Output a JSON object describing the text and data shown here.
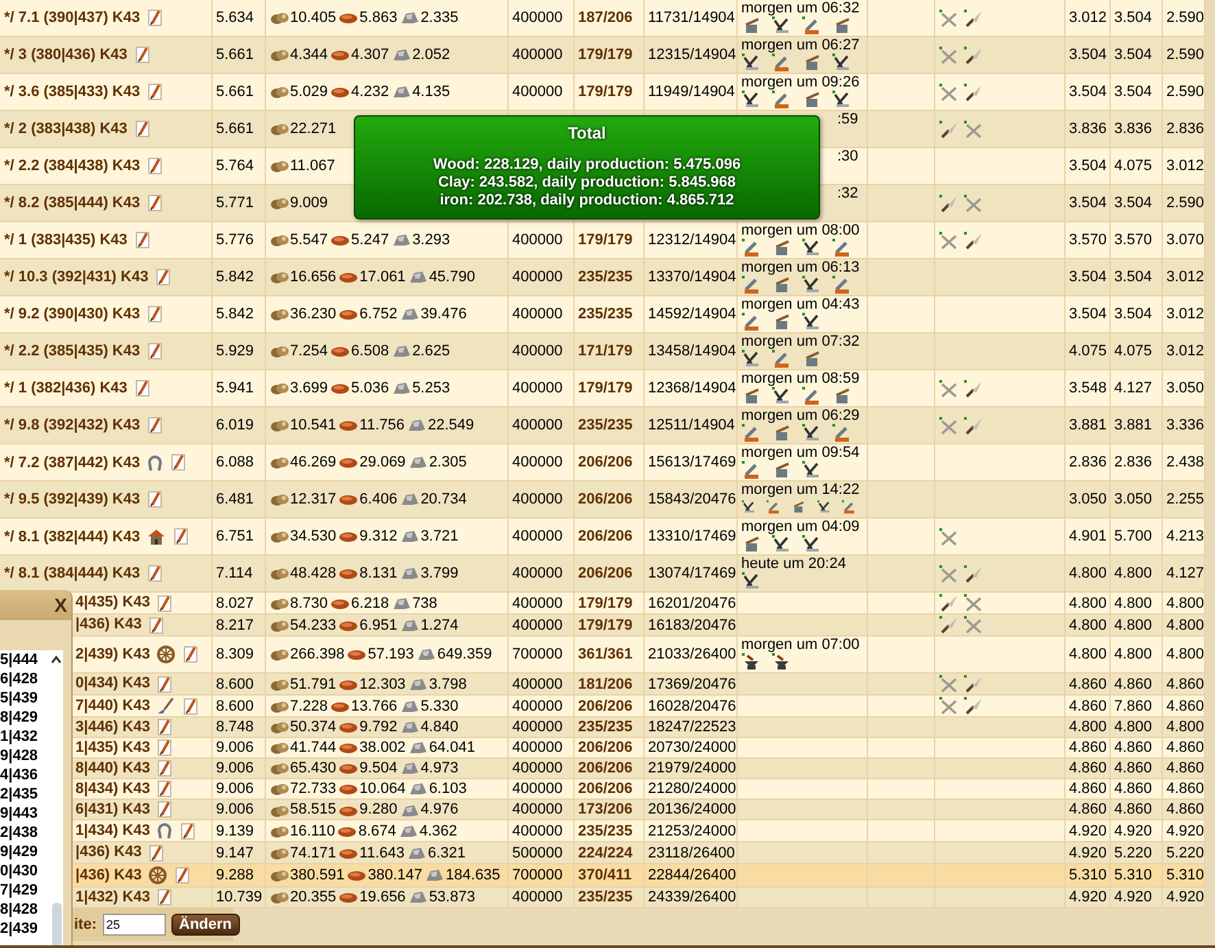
{
  "rows": [
    {
      "name": "*/ 7.1 (390|437) K43",
      "column_2": "5.634",
      "wood": "10.405",
      "clay": "5.863",
      "iron": "2.335",
      "column_4": "400000",
      "column_5": "187/206",
      "column_6": "11731/14904",
      "build": {
        "time": "morgen um 06:32",
        "queue": [
          {
            "kind": "quarry"
          },
          {
            "kind": "axe"
          },
          {
            "kind": "lumber"
          },
          {
            "kind": "quarry"
          }
        ]
      },
      "units": [
        {
          "kind": "crossed"
        },
        {
          "kind": "spear"
        }
      ],
      "column_10": "3.012",
      "column_11": "3.504",
      "column_12": "2.590",
      "selected": false
    },
    {
      "name": "*/ 3 (380|436) K43",
      "column_2": "5.661",
      "wood": "4.344",
      "clay": "4.307",
      "iron": "2.052",
      "column_4": "400000",
      "column_5": "179/179",
      "column_6": "12315/14904",
      "build": {
        "time": "morgen um 06:27",
        "queue": [
          {
            "kind": "axe"
          },
          {
            "kind": "lumber"
          },
          {
            "kind": "quarry"
          },
          {
            "kind": "axe"
          }
        ]
      },
      "units": [
        {
          "kind": "crossed"
        },
        {
          "kind": "spear"
        }
      ],
      "column_10": "3.504",
      "column_11": "3.504",
      "column_12": "2.590",
      "selected": false
    },
    {
      "name": "*/ 3.6 (385|433) K43",
      "column_2": "5.661",
      "wood": "5.029",
      "clay": "4.232",
      "iron": "4.135",
      "column_4": "400000",
      "column_5": "179/179",
      "column_6": "11949/14904",
      "build": {
        "time": "morgen um 09:26",
        "queue": [
          {
            "kind": "axe"
          },
          {
            "kind": "lumber"
          },
          {
            "kind": "quarry"
          },
          {
            "kind": "axe"
          }
        ]
      },
      "units": [
        {
          "kind": "crossed"
        },
        {
          "kind": "spear"
        }
      ],
      "column_10": "3.504",
      "column_11": "3.504",
      "column_12": "2.590",
      "selected": false
    },
    {
      "name": "*/ 2 (383|438) K43",
      "column_2": "5.661",
      "wood": "22.271",
      "build": {
        "time": ":59"
      },
      "units": [
        {
          "kind": "spear"
        },
        {
          "kind": "crossed"
        }
      ],
      "column_10": "3.836",
      "column_11": "3.836",
      "column_12": "2.836",
      "selected": false
    },
    {
      "name": "*/ 2.2 (384|438) K43",
      "column_2": "5.764",
      "wood": "11.067",
      "build": {
        "time": ":30"
      },
      "column_10": "3.504",
      "column_11": "4.075",
      "column_12": "3.012",
      "selected": false
    },
    {
      "name": "*/ 8.2 (385|444) K43",
      "column_2": "5.771",
      "wood": "9.009",
      "build": {
        "time": ":32"
      },
      "units": [
        {
          "kind": "spear"
        },
        {
          "kind": "crossed"
        }
      ],
      "column_10": "3.504",
      "column_11": "3.504",
      "column_12": "2.590",
      "selected": false
    },
    {
      "name": "*/ 1 (383|435) K43",
      "column_2": "5.776",
      "wood": "5.547",
      "clay": "5.247",
      "iron": "3.293",
      "column_4": "400000",
      "column_5": "179/179",
      "column_6": "12312/14904",
      "build": {
        "time": "morgen um 08:00",
        "queue": [
          {
            "kind": "lumber"
          },
          {
            "kind": "quarry"
          },
          {
            "kind": "axe"
          },
          {
            "kind": "lumber"
          }
        ]
      },
      "units": [
        {
          "kind": "crossed"
        },
        {
          "kind": "spear"
        }
      ],
      "column_10": "3.570",
      "column_11": "3.570",
      "column_12": "3.070",
      "selected": false
    },
    {
      "name": "*/ 10.3 (392|431) K43",
      "column_2": "5.842",
      "wood": "16.656",
      "clay": "17.061",
      "iron": "45.790",
      "column_4": "400000",
      "column_5": "235/235",
      "column_6": "13370/14904",
      "build": {
        "time": "morgen um 06:13",
        "queue": [
          {
            "kind": "lumber"
          },
          {
            "kind": "quarry"
          },
          {
            "kind": "axe"
          },
          {
            "kind": "lumber"
          }
        ]
      },
      "column_10": "3.504",
      "column_11": "3.504",
      "column_12": "3.012",
      "selected": false
    },
    {
      "name": "*/ 9.2 (390|430) K43",
      "column_2": "5.842",
      "wood": "36.230",
      "clay": "6.752",
      "iron": "39.476",
      "column_4": "400000",
      "column_5": "235/235",
      "column_6": "14592/14904",
      "build": {
        "time": "morgen um 04:43",
        "queue": [
          {
            "kind": "lumber"
          },
          {
            "kind": "quarry"
          },
          {
            "kind": "axe"
          }
        ]
      },
      "column_10": "3.504",
      "column_11": "3.504",
      "column_12": "3.012",
      "selected": false
    },
    {
      "name": "*/ 2.2 (385|435) K43",
      "column_2": "5.929",
      "wood": "7.254",
      "clay": "6.508",
      "iron": "2.625",
      "column_4": "400000",
      "column_5": "171/179",
      "column_6": "13458/14904",
      "build": {
        "time": "morgen um 07:32",
        "queue": [
          {
            "kind": "axe"
          },
          {
            "kind": "lumber"
          },
          {
            "kind": "quarry"
          }
        ]
      },
      "column_10": "4.075",
      "column_11": "4.075",
      "column_12": "3.012",
      "selected": false
    },
    {
      "name": "*/ 1 (382|436) K43",
      "column_2": "5.941",
      "wood": "3.699",
      "clay": "5.036",
      "iron": "5.253",
      "column_4": "400000",
      "column_5": "179/179",
      "column_6": "12368/14904",
      "build": {
        "time": "morgen um 08:59",
        "queue": [
          {
            "kind": "quarry"
          },
          {
            "kind": "axe"
          },
          {
            "kind": "lumber"
          },
          {
            "kind": "quarry"
          }
        ]
      },
      "units": [
        {
          "kind": "crossed"
        },
        {
          "kind": "spear"
        }
      ],
      "column_10": "3.548",
      "column_11": "4.127",
      "column_12": "3.050",
      "selected": false
    },
    {
      "name": "*/ 9.8 (392|432) K43",
      "column_2": "6.019",
      "wood": "10.541",
      "clay": "11.756",
      "iron": "22.549",
      "column_4": "400000",
      "column_5": "235/235",
      "column_6": "12511/14904",
      "build": {
        "time": "morgen um 06:29",
        "queue": [
          {
            "kind": "lumber"
          },
          {
            "kind": "quarry"
          },
          {
            "kind": "axe"
          },
          {
            "kind": "lumber"
          }
        ]
      },
      "units": [
        {
          "kind": "crossed"
        },
        {
          "kind": "spear"
        }
      ],
      "column_10": "3.881",
      "column_11": "3.881",
      "column_12": "3.336",
      "selected": false
    },
    {
      "name": "*/ 7.2 (387|442) K43",
      "icon": {
        "kind": "horseshoe"
      },
      "column_2": "6.088",
      "wood": "46.269",
      "clay": "29.069",
      "iron": "2.305",
      "column_4": "400000",
      "column_5": "206/206",
      "column_6": "15613/17469",
      "build": {
        "time": "morgen um 09:54",
        "queue": [
          {
            "kind": "lumber"
          },
          {
            "kind": "quarry"
          },
          {
            "kind": "axe"
          }
        ]
      },
      "column_10": "2.836",
      "column_11": "2.836",
      "column_12": "2.438",
      "selected": false
    },
    {
      "name": "*/ 9.5 (392|439) K43",
      "column_2": "6.481",
      "wood": "12.317",
      "clay": "6.406",
      "iron": "20.734",
      "column_4": "400000",
      "column_5": "206/206",
      "column_6": "15843/20476",
      "build": {
        "time": "morgen um 14:22",
        "queue": [
          {
            "kind": "axe"
          },
          {
            "kind": "lumber"
          },
          {
            "kind": "quarry"
          },
          {
            "kind": "axe"
          },
          {
            "kind": "lumber"
          }
        ]
      },
      "column_10": "3.050",
      "column_11": "3.050",
      "column_12": "2.255",
      "selected": false
    },
    {
      "name": "*/ 8.1 (382|444) K43",
      "icon": {
        "kind": "house"
      },
      "column_2": "6.751",
      "wood": "34.530",
      "clay": "9.312",
      "iron": "3.721",
      "column_4": "400000",
      "column_5": "206/206",
      "column_6": "13310/17469",
      "build": {
        "time": "morgen um 04:09",
        "queue": [
          {
            "kind": "quarry"
          },
          {
            "kind": "axe"
          },
          {
            "kind": "axe"
          }
        ]
      },
      "units": [
        {
          "kind": "crossed"
        }
      ],
      "column_10": "4.901",
      "column_11": "5.700",
      "column_12": "4.213",
      "selected": false
    },
    {
      "name": "*/ 8.1 (384|444) K43",
      "column_2": "7.114",
      "wood": "48.428",
      "clay": "8.131",
      "iron": "3.799",
      "column_4": "400000",
      "column_5": "206/206",
      "column_6": "13074/17469",
      "build": {
        "time": "heute um 20:24",
        "queue": [
          {
            "kind": "axe"
          }
        ]
      },
      "units": [
        {
          "kind": "crossed"
        },
        {
          "kind": "spear"
        }
      ],
      "column_10": "4.800",
      "column_11": "4.800",
      "column_12": "4.127",
      "selected": false
    },
    {
      "name": "4|435) K43",
      "column_2": "8.027",
      "wood": "8.730",
      "clay": "6.218",
      "iron": "738",
      "column_4": "400000",
      "column_5": "179/179",
      "column_6": "16201/20476",
      "units": [
        {
          "kind": "spear"
        },
        {
          "kind": "crossed"
        }
      ],
      "column_10": "4.800",
      "column_11": "4.800",
      "column_12": "4.800",
      "selected": false
    },
    {
      "name": "|436) K43",
      "column_2": "8.217",
      "wood": "54.233",
      "clay": "6.951",
      "iron": "1.274",
      "column_4": "400000",
      "column_5": "179/179",
      "column_6": "16183/20476",
      "units": [
        {
          "kind": "spear"
        },
        {
          "kind": "crossed"
        }
      ],
      "column_10": "4.800",
      "column_11": "4.800",
      "column_12": "4.800",
      "selected": false
    },
    {
      "name": "2|439) K43",
      "icon": {
        "kind": "wheel"
      },
      "column_2": "8.309",
      "wood": "266.398",
      "clay": "57.193",
      "iron": "649.359",
      "column_4": "700000",
      "column_5": "361/361",
      "column_6": "21033/26400",
      "build": {
        "time": "morgen um 07:00",
        "queue": [
          {
            "kind": "anvil"
          },
          {
            "kind": "anvil"
          }
        ]
      },
      "column_10": "4.800",
      "column_11": "4.800",
      "column_12": "4.800",
      "selected": false
    },
    {
      "name": "0|434) K43",
      "column_2": "8.600",
      "wood": "51.791",
      "clay": "12.303",
      "iron": "3.798",
      "column_4": "400000",
      "column_5": "181/206",
      "column_6": "17369/20476",
      "units": [
        {
          "kind": "crossed"
        },
        {
          "kind": "spear"
        }
      ],
      "column_10": "4.860",
      "column_11": "4.860",
      "column_12": "4.860",
      "selected": false
    },
    {
      "name": "7|440) K43",
      "icon": {
        "kind": "shovel"
      },
      "column_2": "8.600",
      "wood": "7.228",
      "clay": "13.766",
      "iron": "5.330",
      "column_4": "400000",
      "column_5": "206/206",
      "column_6": "16028/20476",
      "units": [
        {
          "kind": "crossed"
        },
        {
          "kind": "spear"
        }
      ],
      "column_10": "4.860",
      "column_11": "7.860",
      "column_12": "4.860",
      "selected": false
    },
    {
      "name": "3|446) K43",
      "column_2": "8.748",
      "wood": "50.374",
      "clay": "9.792",
      "iron": "4.840",
      "column_4": "400000",
      "column_5": "235/235",
      "column_6": "18247/22523",
      "column_10": "4.800",
      "column_11": "4.800",
      "column_12": "4.800",
      "selected": false
    },
    {
      "name": "1|435) K43",
      "column_2": "9.006",
      "wood": "41.744",
      "clay": "38.002",
      "iron": "64.041",
      "column_4": "400000",
      "column_5": "206/206",
      "column_6": "20730/24000",
      "column_10": "4.860",
      "column_11": "4.860",
      "column_12": "4.860",
      "selected": false
    },
    {
      "name": "8|440) K43",
      "column_2": "9.006",
      "wood": "65.430",
      "clay": "9.504",
      "iron": "4.973",
      "column_4": "400000",
      "column_5": "206/206",
      "column_6": "21979/24000",
      "column_10": "4.860",
      "column_11": "4.860",
      "column_12": "4.860",
      "selected": false
    },
    {
      "name": "8|434) K43",
      "column_2": "9.006",
      "wood": "72.733",
      "clay": "10.064",
      "iron": "6.103",
      "column_4": "400000",
      "column_5": "206/206",
      "column_6": "21280/24000",
      "column_10": "4.860",
      "column_11": "4.860",
      "column_12": "4.860",
      "selected": false
    },
    {
      "name": "6|431) K43",
      "column_2": "9.006",
      "wood": "58.515",
      "clay": "9.280",
      "iron": "4.976",
      "column_4": "400000",
      "column_5": "173/206",
      "column_6": "20136/24000",
      "column_10": "4.860",
      "column_11": "4.860",
      "column_12": "4.860",
      "selected": false
    },
    {
      "name": "1|434) K43",
      "icon": {
        "kind": "horseshoe"
      },
      "column_2": "9.139",
      "wood": "16.110",
      "clay": "8.674",
      "iron": "4.362",
      "column_4": "400000",
      "column_5": "235/235",
      "column_6": "21253/24000",
      "column_10": "4.920",
      "column_11": "4.920",
      "column_12": "4.920",
      "selected": false
    },
    {
      "name": "|436) K43",
      "column_2": "9.147",
      "wood": "74.171",
      "clay": "11.643",
      "iron": "6.321",
      "column_4": "500000",
      "column_5": "224/224",
      "column_6": "23118/26400",
      "column_10": "4.920",
      "column_11": "5.220",
      "column_12": "5.220",
      "selected": false
    },
    {
      "name": "|436) K43",
      "icon": {
        "kind": "wheel"
      },
      "column_2": "9.288",
      "wood": "380.591",
      "clay": "380.147",
      "iron": "184.635",
      "column_4": "700000",
      "column_5": "370/411",
      "column_6": "22844/26400",
      "column_10": "5.310",
      "column_11": "5.310",
      "column_12": "5.310",
      "selected": true
    },
    {
      "name": "1|432) K43",
      "column_2": "10.739",
      "wood": "20.355",
      "clay": "19.656",
      "iron": "53.873",
      "column_4": "400000",
      "column_5": "235/235",
      "column_6": "24339/26400",
      "column_10": "4.920",
      "column_11": "4.920",
      "column_12": "4.920",
      "selected": false
    }
  ],
  "footer": {
    "label": "ite:",
    "value": "25",
    "button": "Ändern"
  },
  "tooltip": {
    "title": "Total",
    "lines": [
      "Wood: 228.129, daily production: 5.475.096",
      "Clay: 243.582, daily production: 5.845.968",
      "iron: 202.738, daily production: 4.865.712"
    ]
  },
  "panel": {
    "close": "X",
    "items": [
      "5|444",
      "6|428",
      "5|439",
      "8|429",
      "1|432",
      "9|428",
      "4|436",
      "2|435",
      "9|443",
      "2|438",
      "9|429",
      "0|430",
      "7|429",
      "8|428",
      "2|439"
    ]
  }
}
